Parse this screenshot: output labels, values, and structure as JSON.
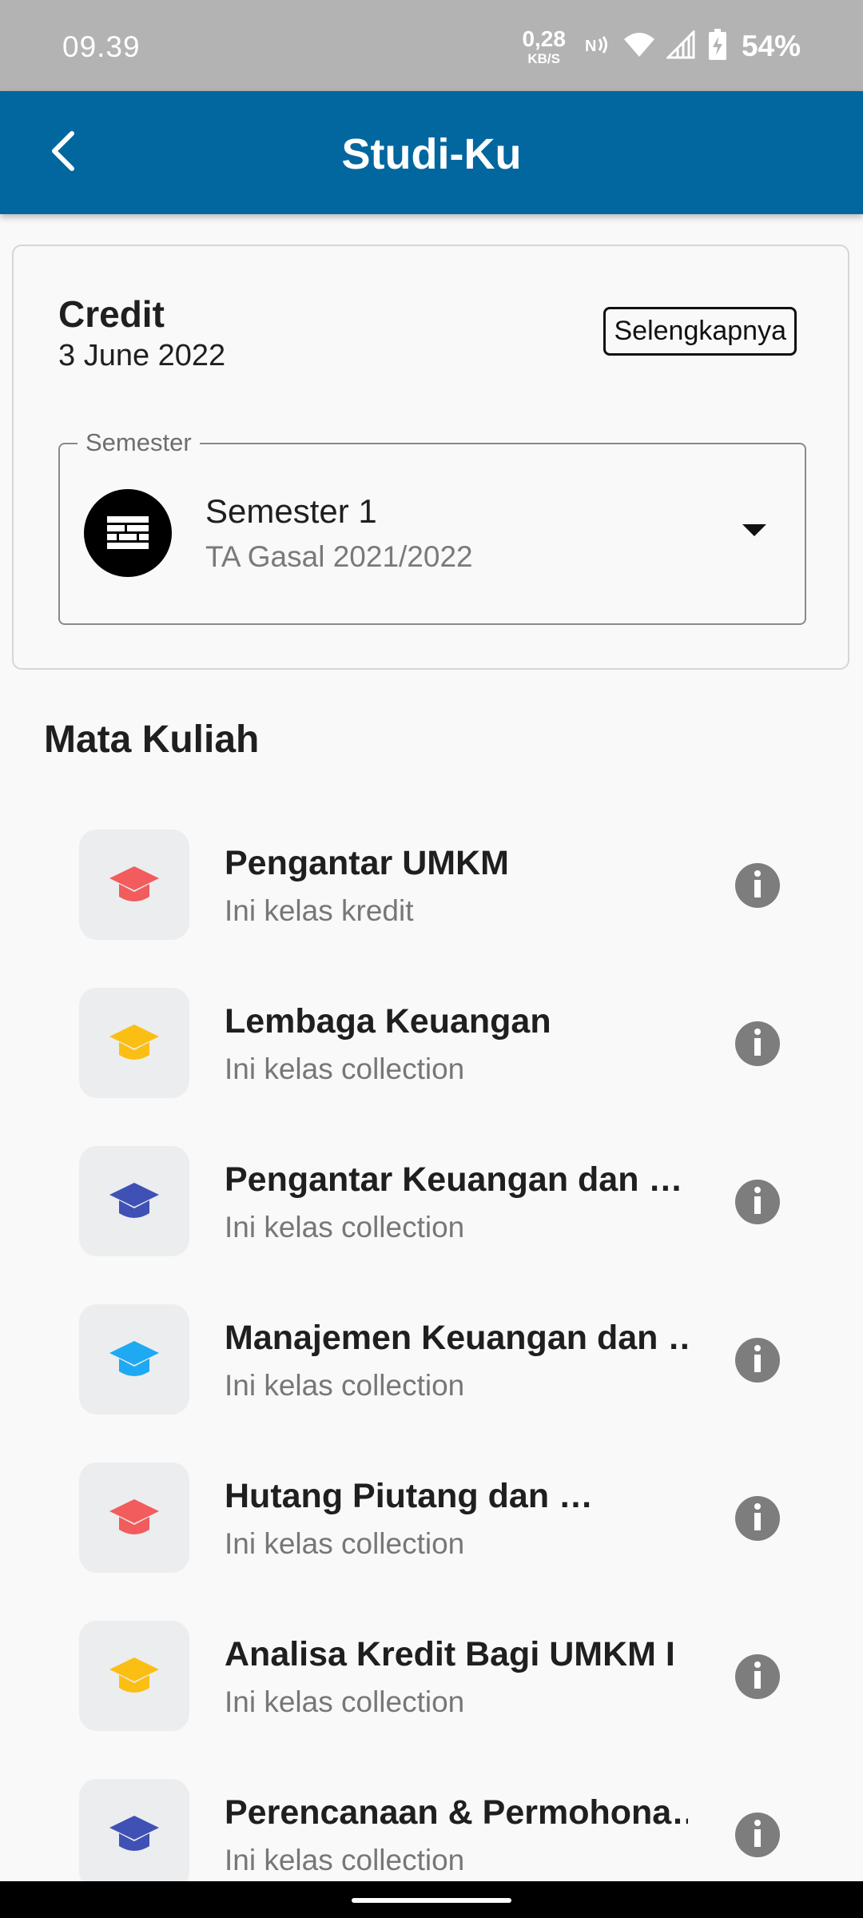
{
  "status_bar": {
    "time": "09.39",
    "net_speed_value": "0,28",
    "net_speed_unit": "KB/S",
    "battery": "54%",
    "icons": [
      "nfc-icon",
      "wifi-icon",
      "signal-icon",
      "battery-charging-icon"
    ]
  },
  "app_bar": {
    "title": "Studi-Ku",
    "back_icon": "chevron-left-icon",
    "color": "#02679e"
  },
  "credit": {
    "title": "Credit",
    "date": "3 June 2022",
    "more_label": "Selengkapnya"
  },
  "semester": {
    "legend": "Semester",
    "selected": "Semester 1",
    "subtitle": "TA Gasal 2021/2022",
    "icon": "wall-icon"
  },
  "courses_section": {
    "title": "Mata Kuliah"
  },
  "courses": [
    {
      "name": "Pengantar UMKM",
      "desc": "Ini kelas kredit",
      "icon_color": "#f25c5c"
    },
    {
      "name": "Lembaga Keuangan",
      "desc": "Ini kelas collection",
      "icon_color": "#fbbf14"
    },
    {
      "name": "Pengantar Keuangan dan …",
      "desc": "Ini kelas collection",
      "icon_color": "#3f51b5"
    },
    {
      "name": "Manajemen Keuangan dan …",
      "desc": "Ini kelas collection",
      "icon_color": "#1fa9f2"
    },
    {
      "name": "Hutang Piutang dan …",
      "desc": "Ini kelas collection",
      "icon_color": "#f25c5c"
    },
    {
      "name": "Analisa Kredit Bagi UMKM I",
      "desc": "Ini kelas collection",
      "icon_color": "#fbbf14"
    },
    {
      "name": "Perencanaan & Permohona…",
      "desc": "Ini kelas collection",
      "icon_color": "#3f51b5"
    }
  ]
}
